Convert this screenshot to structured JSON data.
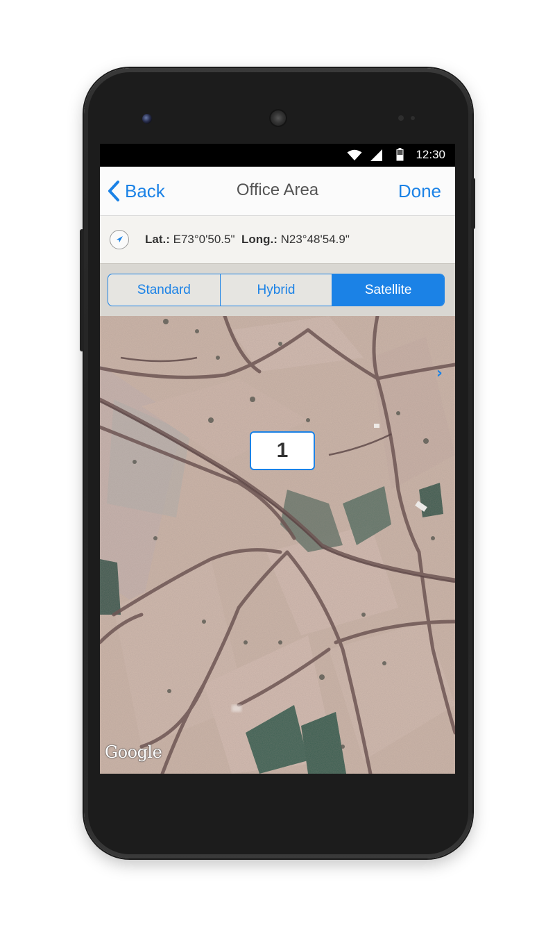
{
  "statusbar": {
    "time": "12:30",
    "icons": [
      "wifi-icon",
      "signal-icon",
      "battery-icon"
    ]
  },
  "navbar": {
    "back_label": "Back",
    "title": "Office Area",
    "done_label": "Done"
  },
  "location": {
    "lat_label": "Lat.:",
    "lat_value": "E73°0'50.5\"",
    "long_label": "Long.:",
    "long_value": "N23°48'54.9\""
  },
  "map_types": {
    "options": [
      "Standard",
      "Hybrid",
      "Satellite"
    ],
    "selected": "Satellite"
  },
  "map": {
    "marker_label": "1",
    "attribution": "Google"
  },
  "colors": {
    "accent": "#1b82e6",
    "navbar_bg": "#fbfbfb",
    "coords_bg": "#f4f3f0"
  }
}
